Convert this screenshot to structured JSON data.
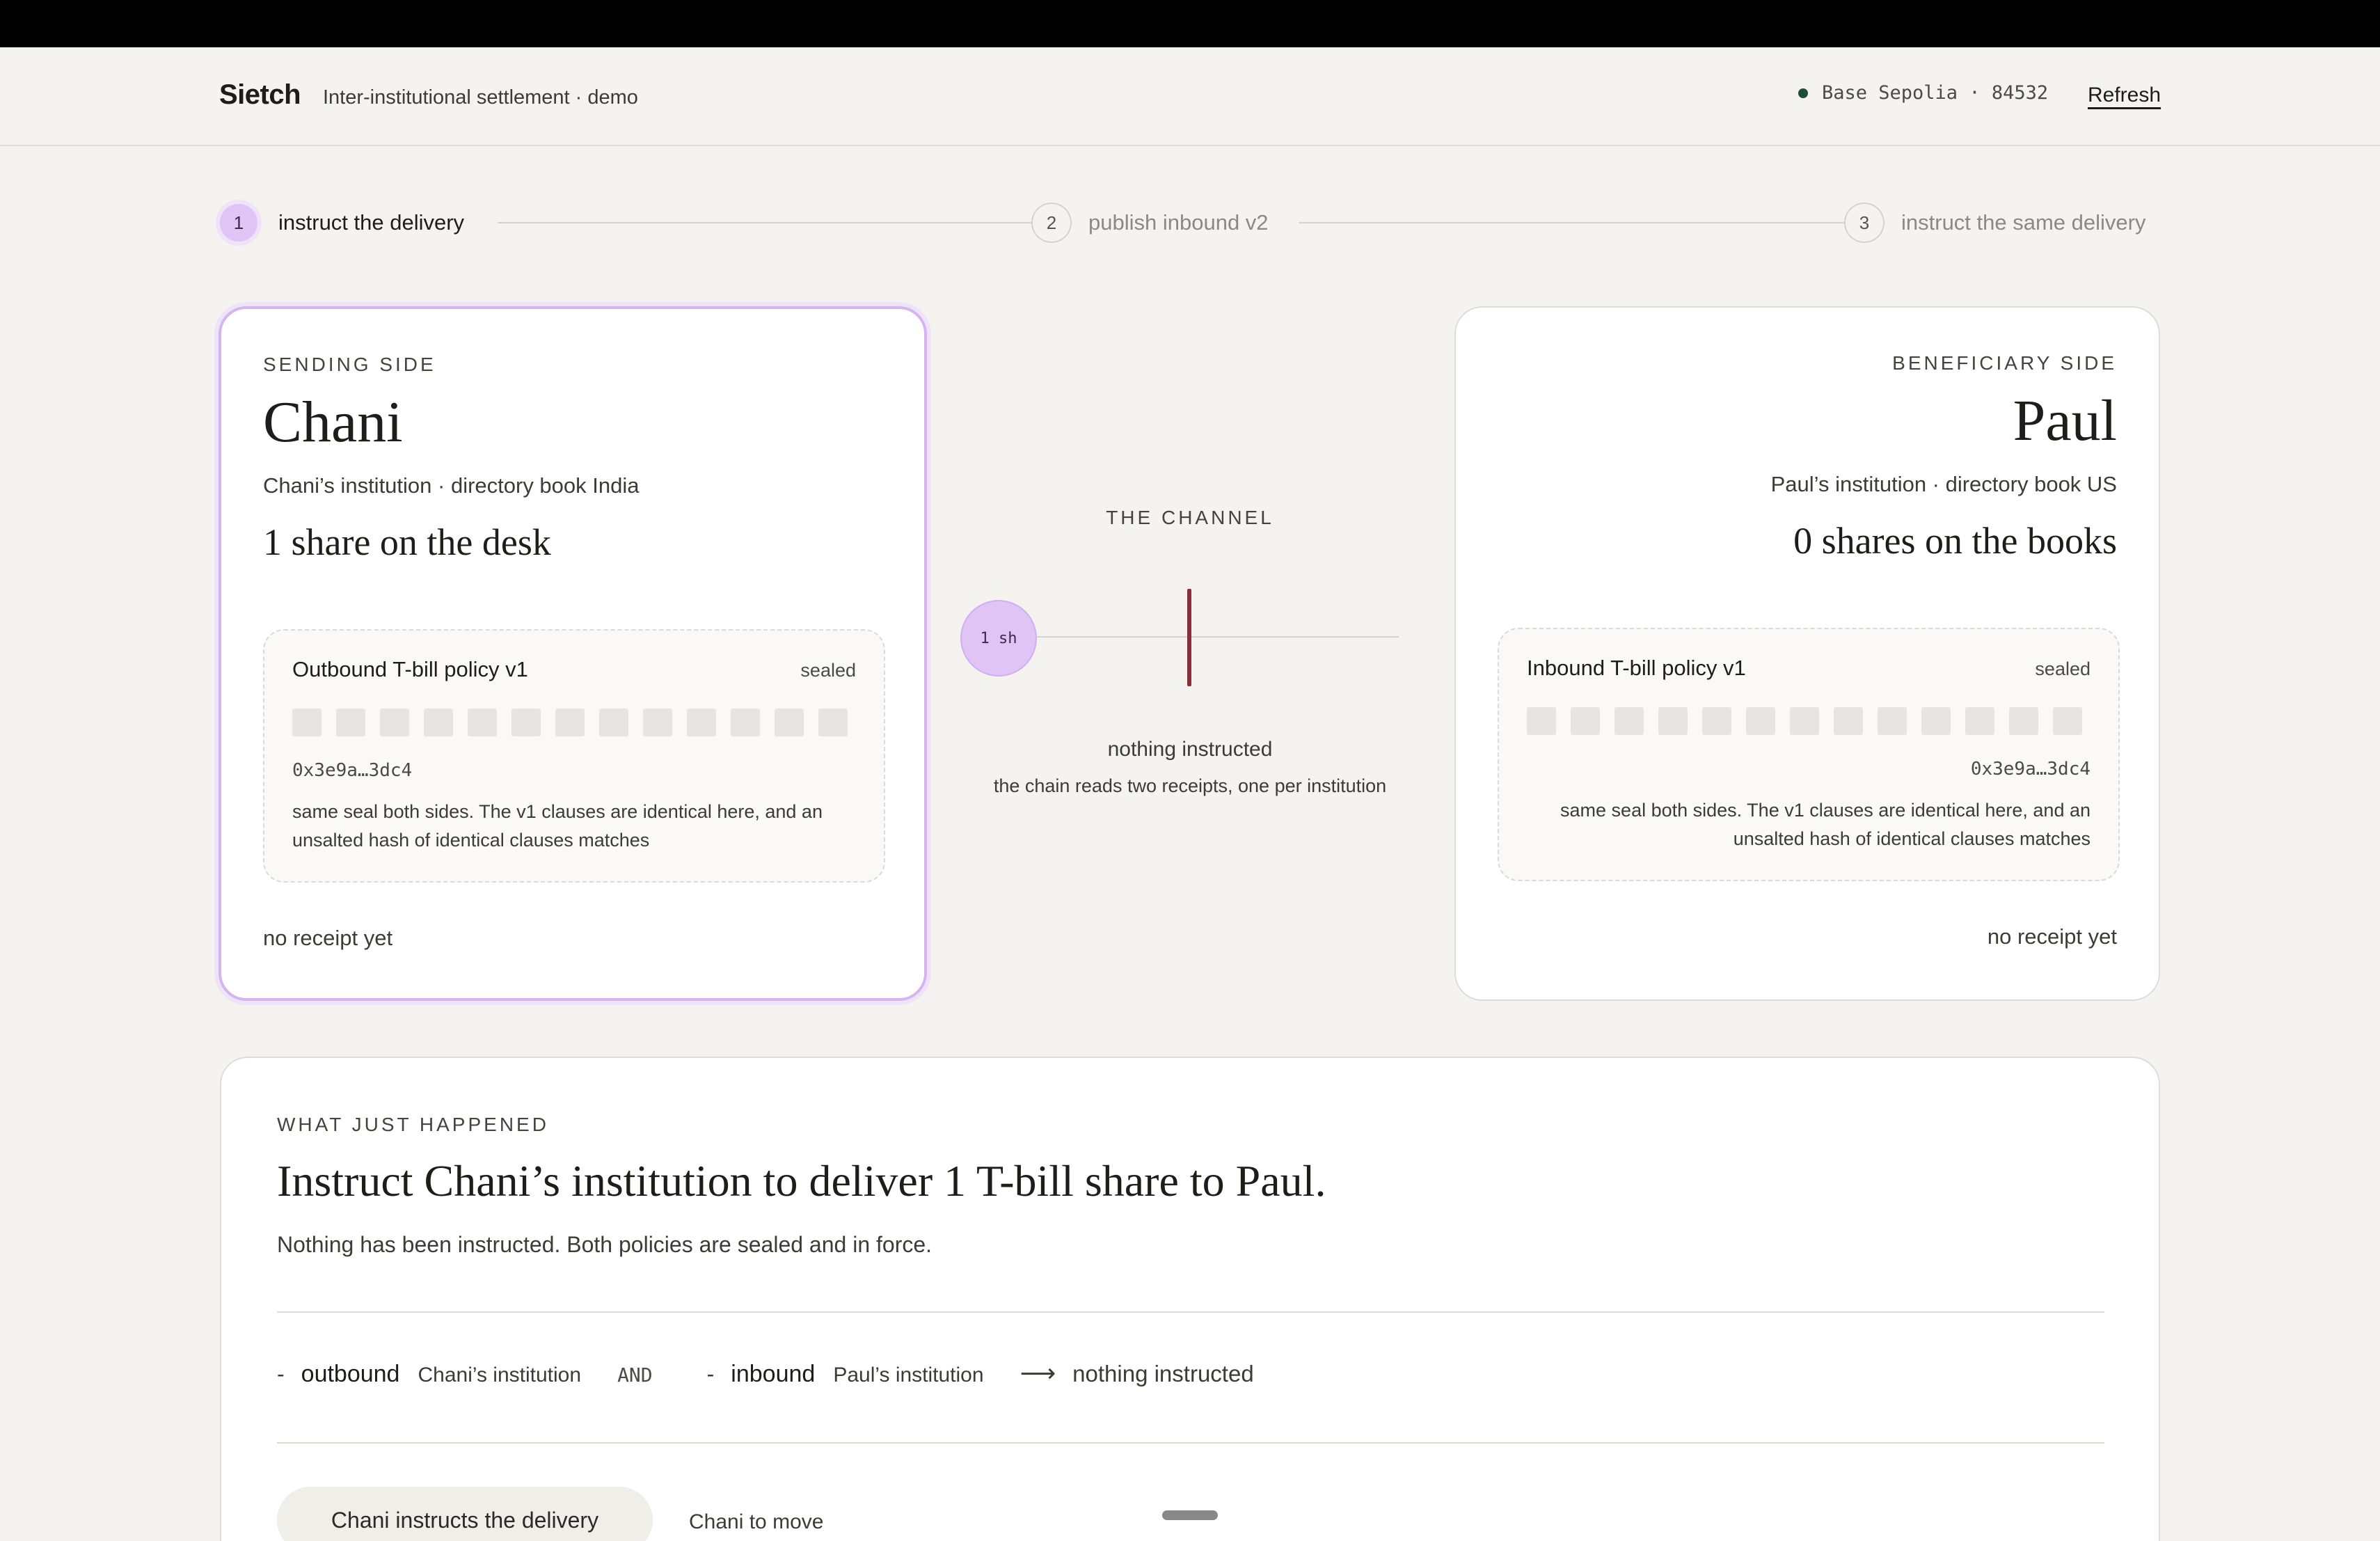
{
  "header": {
    "brand": "Sietch",
    "tagline": "Inter-institutional settlement · demo",
    "network": "Base Sepolia · 84532",
    "refresh_label": "Refresh"
  },
  "stepper": {
    "steps": [
      {
        "num": "1",
        "label": "instruct the delivery",
        "active": true
      },
      {
        "num": "2",
        "label": "publish inbound v2",
        "active": false
      },
      {
        "num": "3",
        "label": "instruct the same delivery",
        "active": false
      }
    ]
  },
  "sending": {
    "side_label": "SENDING SIDE",
    "name": "Chani",
    "institution": "Chani’s institution · directory book India",
    "holdings": "1 share on the desk",
    "policy": {
      "title": "Outbound T-bill policy v1",
      "status": "sealed",
      "hash": "0x3e9a…3dc4",
      "note": "same seal both sides. The v1 clauses are identical here, and an unsalted hash of identical clauses matches"
    },
    "receipt": "no receipt yet"
  },
  "channel": {
    "label": "THE CHANNEL",
    "token": "1 sh",
    "status": "nothing instructed",
    "sub": "the chain reads two receipts, one per institution",
    "bar_color": "#8b2e3a"
  },
  "beneficiary": {
    "side_label": "BENEFICIARY SIDE",
    "name": "Paul",
    "institution": "Paul’s institution · directory book US",
    "holdings": "0 shares on the books",
    "policy": {
      "title": "Inbound T-bill policy v1",
      "status": "sealed",
      "hash": "0x3e9a…3dc4",
      "note": "same seal both sides. The v1 clauses are identical here, and an unsalted hash of identical clauses matches"
    },
    "receipt": "no receipt yet"
  },
  "panel": {
    "kicker": "WHAT JUST HAPPENED",
    "headline": "Instruct Chani’s institution to deliver 1 T-bill share to Paul.",
    "description": "Nothing has been instructed. Both policies are sealed and in force.",
    "formula": {
      "out_dash": "-",
      "out_kw": "outbound",
      "out_who": "Chani’s institution",
      "and": "AND",
      "in_dash": "-",
      "in_kw": "inbound",
      "in_who": "Paul’s institution",
      "arrow": "⟶",
      "result": "nothing instructed"
    },
    "action_label": "Chani instructs the delivery",
    "turn": "Chani to move"
  },
  "colors": {
    "accent": "#e0c4f5",
    "background": "#f4f3f0",
    "network_dot": "#1f4d3d"
  }
}
